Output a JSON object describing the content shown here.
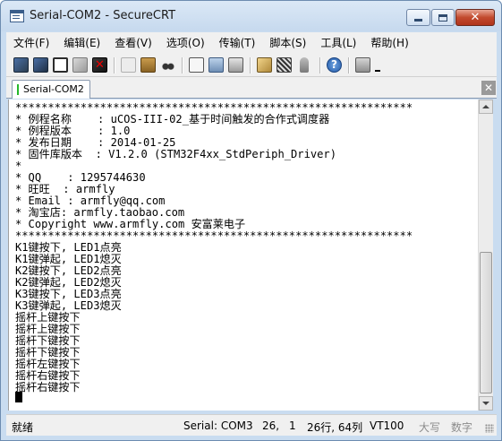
{
  "window": {
    "title": "Serial-COM2 - SecureCRT",
    "controls": {
      "minimize": "minimize",
      "maximize": "maximize",
      "close": "✕"
    }
  },
  "menu": [
    "文件(F)",
    "编辑(E)",
    "查看(V)",
    "选项(O)",
    "传输(T)",
    "脚本(S)",
    "工具(L)",
    "帮助(H)"
  ],
  "toolbar": {
    "icons": [
      "connect-icon",
      "quick-connect-icon",
      "connect-tab-icon",
      "reconnect-icon",
      "disconnect-icon",
      "copy-icon",
      "paste-icon",
      "find-icon",
      "print-setup-icon",
      "print-screen-icon",
      "print-icon",
      "session-options-icon",
      "map-keys-icon",
      "keymap-icon",
      "help-icon",
      "sftp-icon",
      "toolbar-overflow-icon"
    ]
  },
  "tab": {
    "label": "Serial-COM2",
    "status_color": "#26b82a",
    "close": "✕"
  },
  "terminal": {
    "lines": [
      "*************************************************************",
      "* 例程名称    : uCOS-III-02_基于时间触发的合作式调度器",
      "* 例程版本    : 1.0",
      "* 发布日期    : 2014-01-25",
      "* 固件库版本  : V1.2.0 (STM32F4xx_StdPeriph_Driver)",
      "*",
      "* QQ    : 1295744630",
      "* 旺旺  : armfly",
      "* Email : armfly@qq.com",
      "* 淘宝店: armfly.taobao.com",
      "* Copyright www.armfly.com 安富莱电子",
      "*************************************************************",
      "K1键按下, LED1点亮",
      "K1键弹起, LED1熄灭",
      "K2键按下, LED2点亮",
      "K2键弹起, LED2熄灭",
      "K3键按下, LED3点亮",
      "K3键弹起, LED3熄灭",
      "摇杆上键按下",
      "摇杆上键按下",
      "摇杆下键按下",
      "摇杆下键按下",
      "摇杆左键按下",
      "摇杆右键按下",
      "摇杆右键按下"
    ]
  },
  "status": {
    "ready": "就绪",
    "session": "Serial: COM3",
    "row": "26,",
    "col": "1",
    "rows_cols": "26行, 64列",
    "emulation": "VT100",
    "caps": "大写",
    "num": "数字"
  }
}
